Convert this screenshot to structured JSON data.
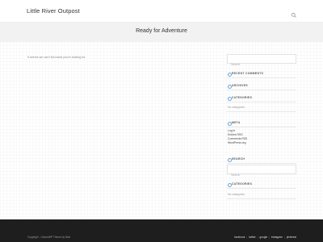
{
  "header": {
    "site_title": "Little River Outpost",
    "search_icon": "search-icon"
  },
  "hero": {
    "title": "Ready for Adventure"
  },
  "main": {
    "not_found_text": "It seems we can't find what you're looking for."
  },
  "sidebar": {
    "search_placeholder": "Search",
    "recent_comments_title": "RECENT COMMENTS",
    "archives_title": "ARCHIVES",
    "categories_title": "CATEGORIES",
    "categories_empty": "No categories",
    "meta_title": "META",
    "meta_links": [
      "Log in",
      "Entries RSS",
      "Comments RSS",
      "WordPress.org"
    ],
    "search_title": "SEARCH",
    "search2_placeholder": "Search",
    "categories2_title": "CATEGORIES",
    "categories2_empty": "No categories"
  },
  "footer": {
    "copyright": "Copyright - OceanWP Theme by Nick",
    "social": [
      "facebook",
      "twitter",
      "google",
      "instagram",
      "pinterest"
    ]
  },
  "colors": {
    "accent": "#6ba5d7",
    "footer_bg": "#1e1e1e",
    "hero_bg": "#f2f2f2"
  }
}
